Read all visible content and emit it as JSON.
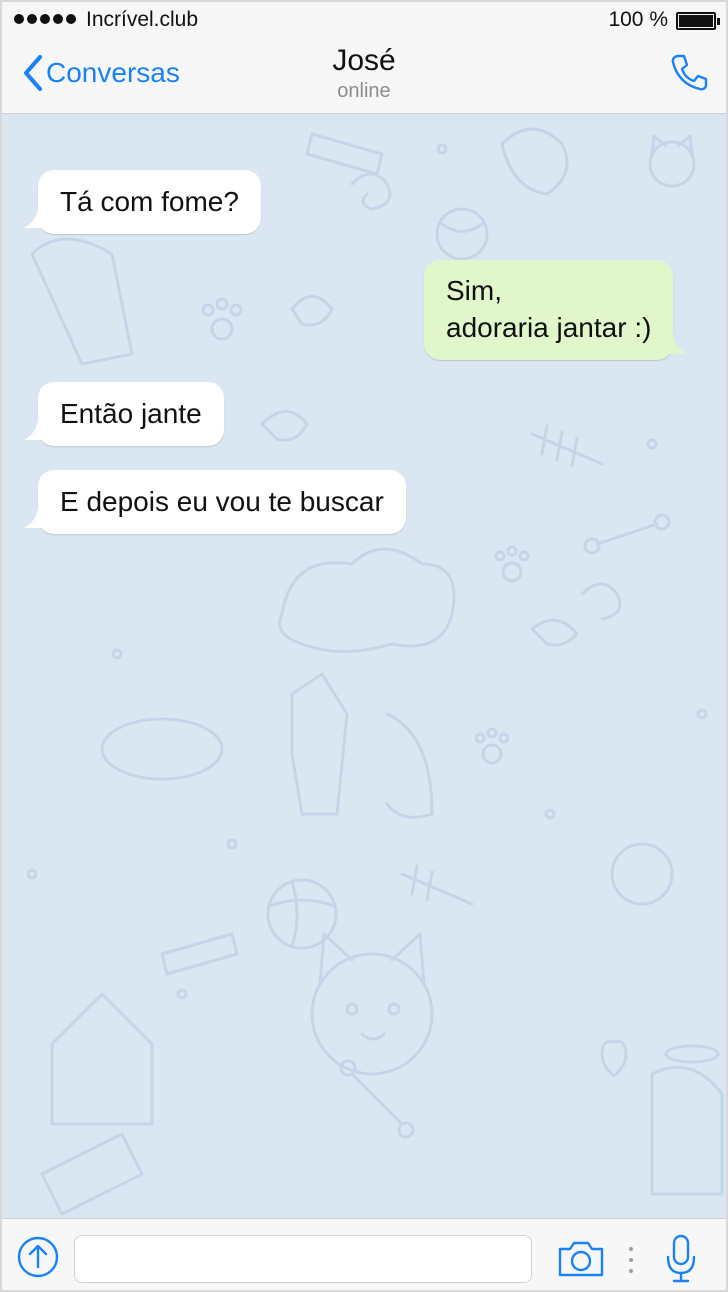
{
  "status_bar": {
    "signal_dots": 5,
    "carrier": "Incrível.club",
    "battery_percent": "100 %",
    "battery_level": 1.0
  },
  "nav_bar": {
    "back_label": "Conversas",
    "contact_name": "José",
    "contact_status": "online",
    "icons": {
      "back": "chevron-left-icon",
      "call": "phone-icon"
    },
    "accent_color": "#1a82f7"
  },
  "chat": {
    "background_color": "#dbe6f3",
    "incoming_bubble_color": "#ffffff",
    "outgoing_bubble_color": "#e1f7cb",
    "messages": [
      {
        "direction": "incoming",
        "lines": [
          "Tá com fome?"
        ]
      },
      {
        "direction": "outgoing",
        "lines": [
          "Sim,",
          "adoraria jantar :)"
        ]
      },
      {
        "direction": "incoming",
        "lines": [
          "Então jante"
        ]
      },
      {
        "direction": "incoming",
        "lines": [
          "E depois eu vou te buscar"
        ]
      }
    ]
  },
  "input_bar": {
    "message_value": "",
    "icons": {
      "attach": "arrow-up-circle-icon",
      "camera": "camera-icon",
      "mic": "microphone-icon"
    }
  }
}
